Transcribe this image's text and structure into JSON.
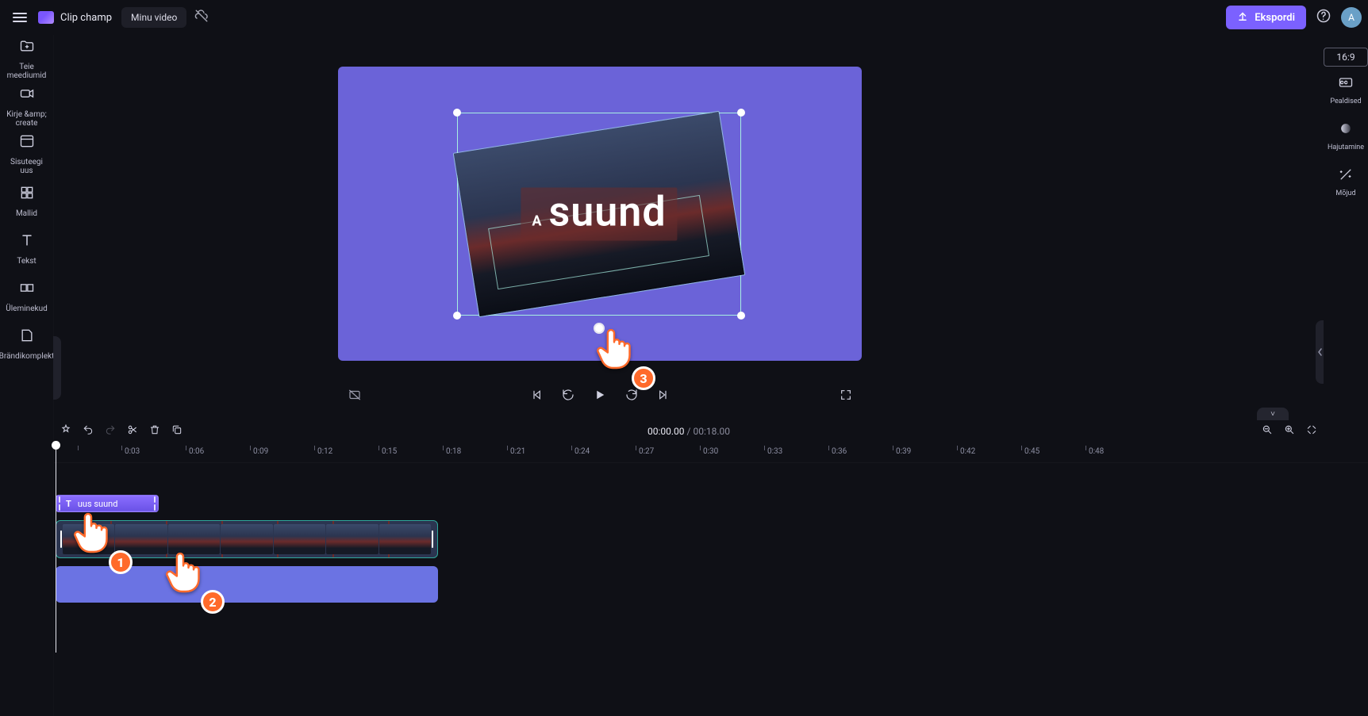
{
  "app": {
    "brand": "Clip champ",
    "title": "Minu video"
  },
  "topbar": {
    "export_label": "Ekspordi",
    "avatar_initial": "A"
  },
  "sidebar": {
    "items": [
      {
        "label": "Teie meediumid"
      },
      {
        "label_a": "Kirje &amp;",
        "label_b": "create"
      },
      {
        "label_a": "Sisuteegi",
        "label_b": "uus"
      },
      {
        "label": "Mallid"
      },
      {
        "label": "Tekst"
      },
      {
        "label": "Üleminekud"
      },
      {
        "label": "Brändikomplekt"
      }
    ]
  },
  "rightbar": {
    "aspect": "16:9",
    "items": [
      {
        "label": "Pealdised"
      },
      {
        "label": "Hajutamine"
      },
      {
        "label": "Mõjud"
      }
    ]
  },
  "preview": {
    "text_small": "A",
    "text_big": "suund"
  },
  "hands": {
    "h1": "1",
    "h2": "2",
    "h3": "3"
  },
  "timeline": {
    "current": "00:00.00",
    "duration": "00:18.00",
    "ticks": [
      "0:03",
      "0:06",
      "0:09",
      "0:12",
      "0:15",
      "0:18",
      "0:21",
      "0:24",
      "0:27",
      "0:30",
      "0:33",
      "0:36",
      "0:39",
      "0:42",
      "0:45",
      "0:48"
    ],
    "text_clip_label": "uus suund"
  }
}
